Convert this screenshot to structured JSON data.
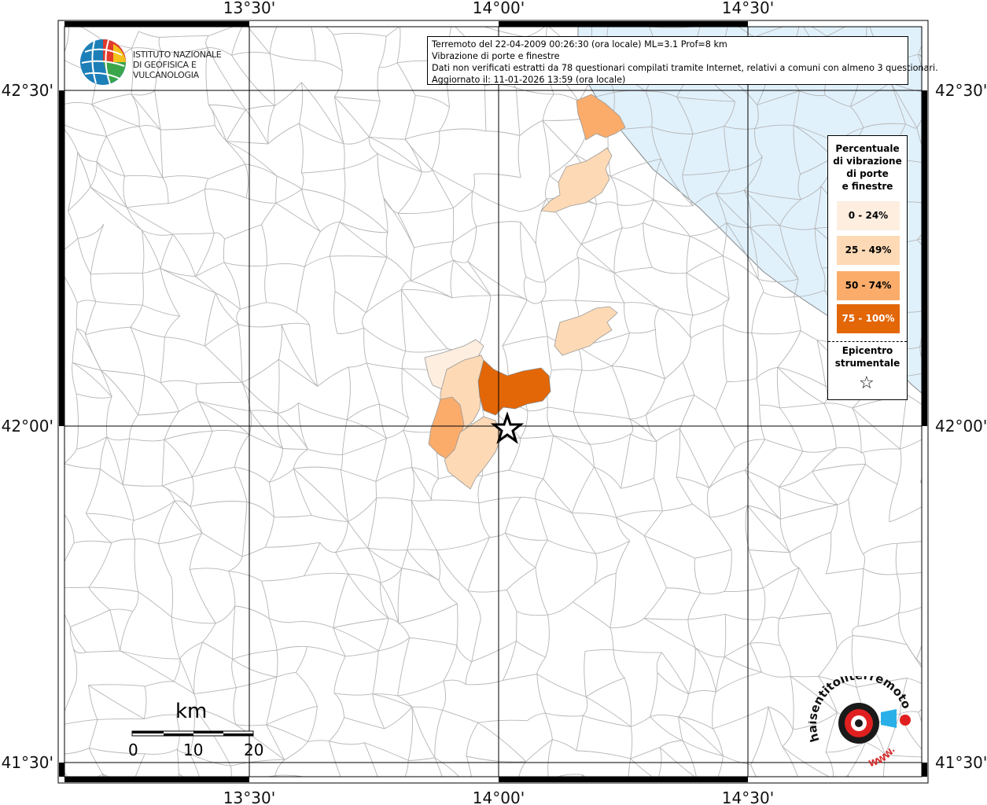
{
  "map": {
    "lon_labels": [
      "13°30'",
      "14°00'",
      "14°30'"
    ],
    "lat_labels": [
      "42°30'",
      "42°00'",
      "41°30'"
    ]
  },
  "info": {
    "line1": "Terremoto del 22-04-2009 00:26:30 (ora locale) ML=3.1 Prof=8 km",
    "line2": "Vibrazione di porte e finestre",
    "line3": "Dati non verificati estratti da 78 questionari compilati tramite Internet, relativi a comuni con almeno 3 questionari.",
    "line4": "Aggiornato il: 11-01-2026 13:59 (ora locale)"
  },
  "logo_ingv": {
    "line1": "ISTITUTO NAZIONALE",
    "line2": "DI GEOFISICA E VULCANOLOGIA"
  },
  "legend": {
    "title_l1": "Percentuale",
    "title_l2": "di vibrazione",
    "title_l3": "di porte",
    "title_l4": "e finestre",
    "classes": [
      {
        "label": "0 - 24%",
        "color": "#fdeee0"
      },
      {
        "label": "25 - 49%",
        "color": "#fdd9b5"
      },
      {
        "label": "50 - 74%",
        "color": "#fbac6b"
      },
      {
        "label": "75 - 100%",
        "color": "#e36607"
      }
    ],
    "epicenter_l1": "Epicentro",
    "epicenter_l2": "strumentale",
    "epicenter_symbol": "☆"
  },
  "scale_bar": {
    "unit": "km",
    "labels": [
      "0",
      "10",
      "20"
    ]
  },
  "logo_hst": {
    "text": "haisentitoilterremoto.it",
    "sub": "WWW."
  },
  "colors": {
    "sea": "#e0f1fc",
    "grid": "#000000",
    "boundary": "#b8b8b8"
  }
}
